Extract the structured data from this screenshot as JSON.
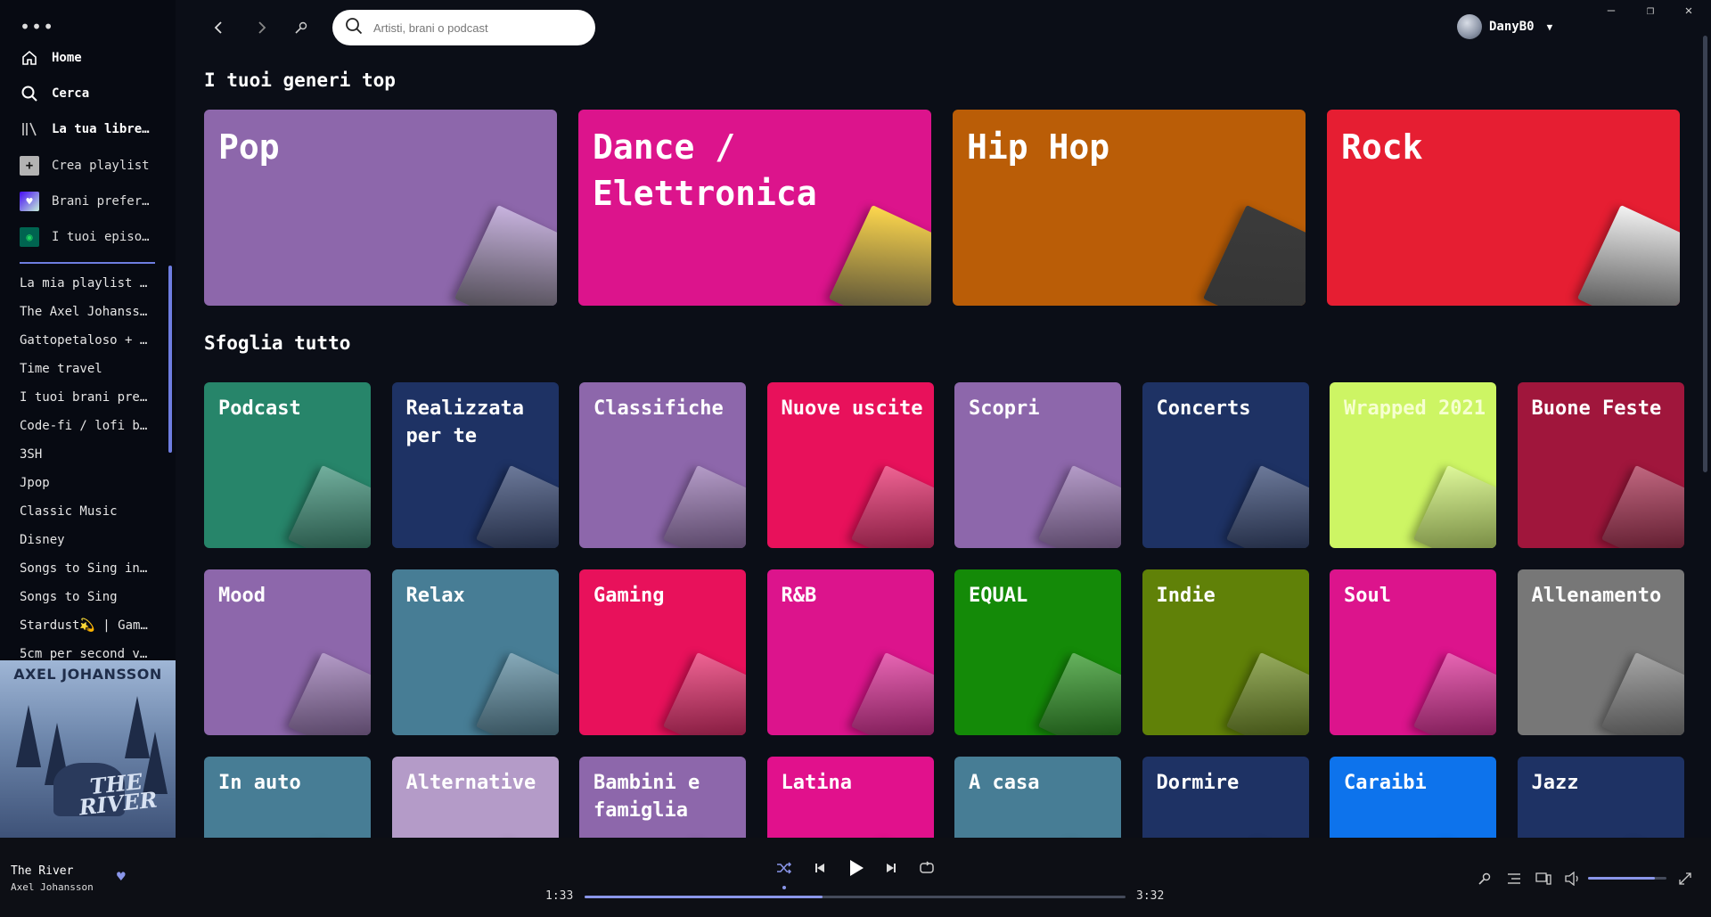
{
  "window": {
    "menu": "•••",
    "user": "DanyB0"
  },
  "nav": {
    "home": "Home",
    "search": "Cerca",
    "library": "La tua libre…",
    "create_playlist": "Crea playlist",
    "liked_songs": "Brani prefer…",
    "episodes": "I tuoi episo…"
  },
  "playlists": [
    "La mia playlist …",
    "The Axel Johanss…",
    "Gattopetaloso + …",
    "Time travel",
    "I tuoi brani pre…",
    "Code-fi / lofi b…",
    "3SH",
    "Jpop",
    "Classic Music",
    "Disney",
    "Songs to Sing in…",
    "Songs to Sing",
    "Stardust💫 | Gam…",
    "5cm per second v…"
  ],
  "cover": {
    "artist": "AXEL JOHANSSON",
    "title": "THE RIVER"
  },
  "search": {
    "placeholder": "Artisti, brani o podcast"
  },
  "sections": {
    "top_genres": "I tuoi generi top",
    "browse_all": "Sfoglia tutto"
  },
  "top_genres": [
    {
      "label": "Pop",
      "color": "#8d67ab"
    },
    {
      "label": "Dance / Elettronica",
      "color": "#dc148c"
    },
    {
      "label": "Hip Hop",
      "color": "#ba5d07"
    },
    {
      "label": "Rock",
      "color": "#e61e32"
    }
  ],
  "browse": [
    {
      "label": "Podcast",
      "color": "#27856a"
    },
    {
      "label": "Realizzata per te",
      "color": "#1e3264"
    },
    {
      "label": "Classifiche",
      "color": "#8d67ab"
    },
    {
      "label": "Nuove uscite",
      "color": "#e8115b"
    },
    {
      "label": "Scopri",
      "color": "#8d67ab"
    },
    {
      "label": "Concerts",
      "color": "#1e3264"
    },
    {
      "label": "Wrapped 2021",
      "color": "#cdf564"
    },
    {
      "label": "Buone Feste",
      "color": "#a0163c"
    },
    {
      "label": "Mood",
      "color": "#8d67ab"
    },
    {
      "label": "Relax",
      "color": "#477d95"
    },
    {
      "label": "Gaming",
      "color": "#e8115b"
    },
    {
      "label": "R&B",
      "color": "#dc148c"
    },
    {
      "label": "EQUAL",
      "color": "#148a08"
    },
    {
      "label": "Indie",
      "color": "#608108"
    },
    {
      "label": "Soul",
      "color": "#dc148c"
    },
    {
      "label": "Allenamento",
      "color": "#777777"
    },
    {
      "label": "In auto",
      "color": "#477d95"
    },
    {
      "label": "Alternative",
      "color": "#b49bc8"
    },
    {
      "label": "Bambini e famiglia",
      "color": "#8d67ab"
    },
    {
      "label": "Latina",
      "color": "#e1118c"
    },
    {
      "label": "A casa",
      "color": "#477d95"
    },
    {
      "label": "Dormire",
      "color": "#1e3264"
    },
    {
      "label": "Caraibi",
      "color": "#0d73ec"
    },
    {
      "label": "Jazz",
      "color": "#1e3264"
    }
  ],
  "player": {
    "title": "The River",
    "artist": "Axel Johansson",
    "elapsed": "1:33",
    "total": "3:32",
    "progress": 0.44,
    "volume": 0.85,
    "accent": "#8a96ea"
  }
}
